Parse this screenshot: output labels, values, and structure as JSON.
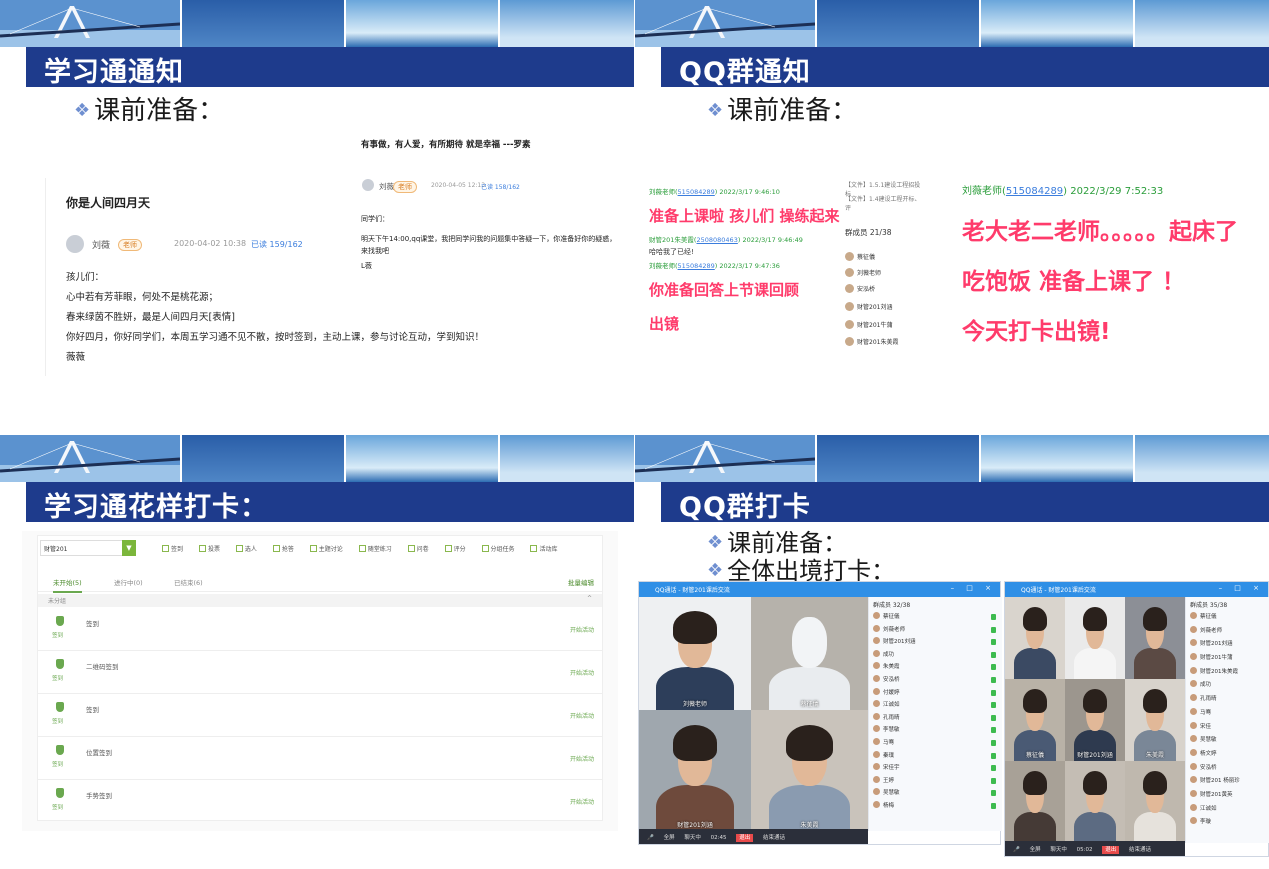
{
  "quads": [
    {
      "title": "学习通通知",
      "bullet": "课前准备：",
      "notice": {
        "title": "你是人间四月天",
        "author": "刘薇",
        "tag": "老师",
        "date": "2020-04-02 10:38",
        "read": "已读 159/162",
        "lines": [
          "孩儿们：",
          "心中若有芳菲眼，何处不是桃花源；",
          "春来绿茵不胜妍，最是人间四月天[表情]",
          "你好四月，你好同学们，本周五学习通不见不散，按时签到，主动上课，参与讨论互动，学到知识！",
          "薇薇"
        ]
      },
      "message": {
        "motto": "有事做，有人爱，有所期待 就是幸福 ---罗素",
        "author": "刘薇",
        "tag": "老师",
        "date": "2020-04-05 12:13",
        "read": "已读 158/162",
        "lines": [
          "同学们：",
          "明天下午14:00,qq课堂，我把同学问我的问题集中答疑一下，你准备好你的疑惑，来找我吧",
          "L薇"
        ]
      }
    },
    {
      "title": "QQ群通知",
      "bullet": "课前准备：",
      "chat": [
        {
          "sender": "刘薇老师",
          "qq": "515084289",
          "time": "2022/3/17 9:46:10"
        },
        {
          "big": "准备上课啦  孩儿们 操练起来"
        },
        {
          "sender": "财管201朱美霞",
          "qq": "2508080463",
          "time": "2022/3/17 9:46:49"
        },
        {
          "plain": "哈哈我了已经!"
        },
        {
          "sender": "刘薇老师",
          "qq": "515084289",
          "time": "2022/3/17 9:47:36"
        },
        {
          "big": "你准备回答上节课回顾"
        },
        {
          "big": "出镜"
        }
      ],
      "members": {
        "files": [
          "【文件】1.5.1建设工程招投标",
          "【文件】1.4建设工程开标、评"
        ],
        "header": "群成员 21/38",
        "names": [
          "蔡征儀",
          "刘薇老师",
          "安泓桥",
          "财管201刘涵",
          "财管201牛蒲",
          "财管201朱美霞"
        ]
      },
      "big_chat": {
        "sender": "刘薇老师",
        "qq": "515084289",
        "time": "2022/3/29 7:52:33",
        "lines": [
          "老大老二老师。。。。。起床了",
          "吃饱饭 准备上课了 ！",
          "今天打卡出镜!"
        ]
      }
    },
    {
      "title": "学习通花样打卡：",
      "select": "财管201",
      "tools": [
        "签到",
        "投票",
        "选人",
        "抢答",
        "主题讨论",
        "随堂练习",
        "问卷",
        "评分",
        "分组任务",
        "活动库"
      ],
      "tabs": [
        "未开始(5)",
        "进行中(0)",
        "已结束(6)"
      ],
      "bulk": "批量编辑",
      "group": "未分组",
      "icon_label": "签到",
      "start_label": "开始活动",
      "activities": [
        "签到",
        "二维码签到",
        "签到",
        "位置签到",
        "手势签到"
      ]
    },
    {
      "title": "QQ群打卡",
      "bullets": [
        "课前准备：",
        "全体出境打卡："
      ],
      "windows": [
        {
          "title": "QQ通话 - 财管201课后交流",
          "member_header": "群成员 32/38",
          "tiles": [
            "刘薇老师",
            "蔡征儀",
            "财管201刘涵",
            "朱美霞"
          ],
          "members": [
            "蔡征儀",
            "刘薇老师",
            "财管201刘涵",
            "成功",
            "朱美霞",
            "安泓桥",
            "付媛婷",
            "江诚如",
            "孔雨晴",
            "李慧敏",
            "马骞",
            "秦璞",
            "宋佳宇",
            "王婷",
            "吴慧敏",
            "杨梅"
          ],
          "controls": [
            "全屏",
            "聊天中",
            "02:45",
            "退出",
            "结束通话"
          ]
        },
        {
          "title": "QQ通话 - 财管201课后交流",
          "member_header": "群成员 35/38",
          "tiles": [
            "蔡征儀",
            "财管201刘涵",
            "朱美霞"
          ],
          "members": [
            "蔡征儀",
            "刘薇老师",
            "财管201刘涵",
            "财管201牛蒲",
            "财管201朱美霞",
            "成功",
            "孔雨晴",
            "马骞",
            "宋佳",
            "吴慧敏",
            "杨文婷",
            "安泓桥",
            "财管201 杨丽珍",
            "财管201黄英",
            "江诚如",
            "李璇"
          ],
          "controls": [
            "全屏",
            "聊天中",
            "05:02",
            "退出",
            "结束通话"
          ]
        }
      ]
    }
  ]
}
